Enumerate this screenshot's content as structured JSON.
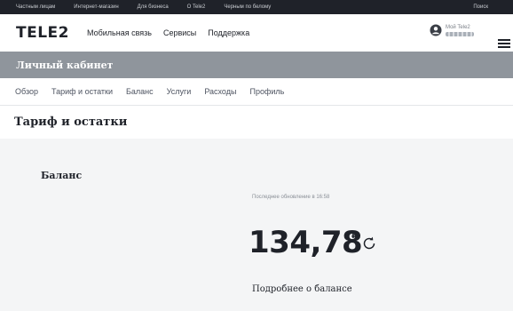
{
  "topbar": {
    "items": [
      "Частным лицам",
      "Интернет-магазин",
      "Для бизнеса",
      "О Tele2",
      "Черным по белому"
    ],
    "search_label": "Поиск"
  },
  "header": {
    "logo": "TELE2",
    "nav": [
      "Мобильная связь",
      "Сервисы",
      "Поддержка"
    ],
    "account_label": "Мой Tele2",
    "account_icon": "user-icon",
    "menu_icon": "hamburger-icon"
  },
  "cabinet": {
    "title": "Личный кабинет"
  },
  "subnav": {
    "tabs": [
      "Обзор",
      "Тариф и остатки",
      "Баланс",
      "Услуги",
      "Расходы",
      "Профиль"
    ]
  },
  "page": {
    "title": "Тариф и остатки"
  },
  "balance": {
    "heading": "Баланс",
    "updated": "Последнее обновление в 16:58",
    "amount": "134,78",
    "currency": "₽",
    "refresh_icon": "refresh-icon",
    "details_link": "Подробнее о балансе"
  },
  "colors": {
    "topbar": "#1f2229",
    "cabinet_bar": "#8f959c",
    "background": "#f4f5f6"
  }
}
